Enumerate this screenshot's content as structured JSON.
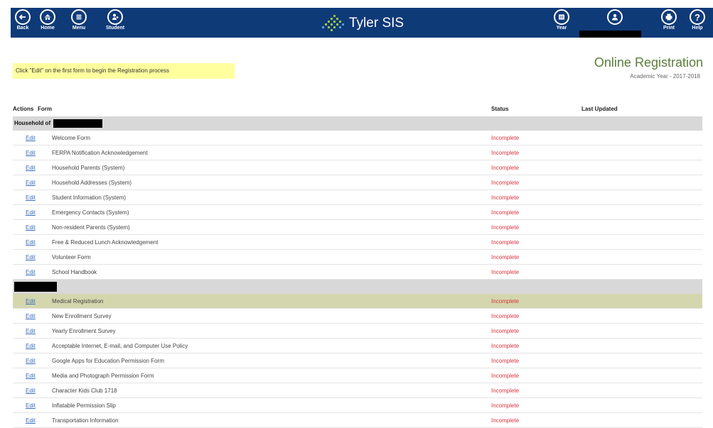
{
  "nav": {
    "back": "Back",
    "home": "Home",
    "menu": "Menu",
    "student": "Student",
    "year": "Year",
    "print": "Print",
    "help": "Help",
    "brand": "Tyler SIS"
  },
  "instruction": "Click \"Edit\" on the first form to begin the Registration process",
  "page": {
    "title": "Online Registration",
    "academic_year": "Academic Year - 2017-2018"
  },
  "table": {
    "headers": {
      "actions": "Actions",
      "form": "Form",
      "status": "Status",
      "last_updated": "Last Updated"
    },
    "group1_label": "Household of",
    "edit_label": "Edit",
    "household_rows": [
      {
        "form": "Welcome Form",
        "status": "Incomplete"
      },
      {
        "form": "FERPA Notification Acknowledgement",
        "status": "Incomplete"
      },
      {
        "form": "Household Parents (System)",
        "status": "Incomplete"
      },
      {
        "form": "Household Addresses (System)",
        "status": "Incomplete"
      },
      {
        "form": "Student Information (System)",
        "status": "Incomplete"
      },
      {
        "form": "Emergency Contacts (System)",
        "status": "Incomplete"
      },
      {
        "form": "Non-resident Parents (System)",
        "status": "Incomplete"
      },
      {
        "form": "Free & Reduced Lunch Acknowledgement",
        "status": "Incomplete"
      },
      {
        "form": "Volunteer Form",
        "status": "Incomplete"
      },
      {
        "form": "School Handbook",
        "status": "Incomplete"
      }
    ],
    "student_rows": [
      {
        "form": "Medical Registration",
        "status": "Incomplete"
      },
      {
        "form": "New Enrollment Survey",
        "status": "Incomplete"
      },
      {
        "form": "Yearly Enrollment Survey",
        "status": "Incomplete"
      },
      {
        "form": "Acceptable Internet, E-mail, and Computer Use Policy",
        "status": "Incomplete"
      },
      {
        "form": "Google Apps for Education Permission Form",
        "status": "Incomplete"
      },
      {
        "form": "Media and Photograph Permission Form",
        "status": "Incomplete"
      },
      {
        "form": "Character Kids Club 1718",
        "status": "Incomplete"
      },
      {
        "form": "Inflatable Permission Slip",
        "status": "Incomplete"
      },
      {
        "form": "Transportation Information",
        "status": "Incomplete"
      }
    ]
  }
}
